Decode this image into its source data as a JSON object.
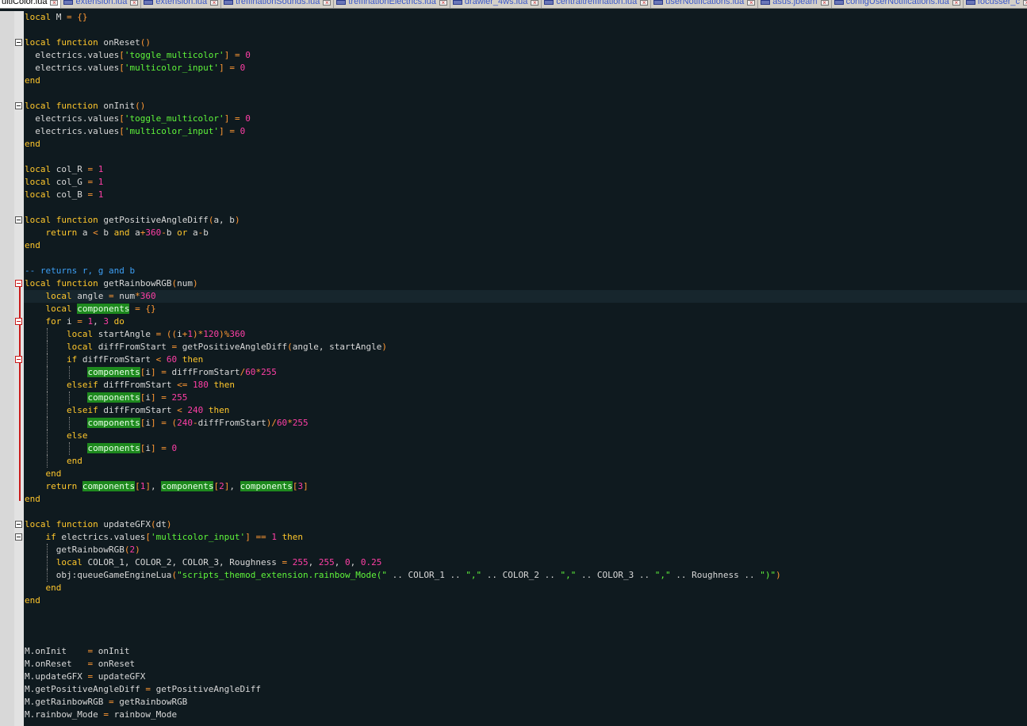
{
  "tabs": [
    {
      "label": "ultiColor.lua",
      "active": true
    },
    {
      "label": "extension.lua"
    },
    {
      "label": "extension.lua"
    },
    {
      "label": "treffinationSounds.lua"
    },
    {
      "label": "treffinationElectrics.lua"
    },
    {
      "label": "drawler_4ws.lua"
    },
    {
      "label": "centraltreffination.lua"
    },
    {
      "label": "userNotifications.lua"
    },
    {
      "label": "asus.jbeam"
    },
    {
      "label": "configUserNotifications.lua"
    },
    {
      "label": "focusser_c"
    }
  ],
  "editor": {
    "current_line": 23,
    "lines": [
      {
        "text": "local M = {}"
      },
      {
        "text": ""
      },
      {
        "text": "local function onReset()",
        "fold": true
      },
      {
        "text": "  electrics.values['toggle_multicolor'] = 0"
      },
      {
        "text": "  electrics.values['multicolor_input'] = 0"
      },
      {
        "text": "end"
      },
      {
        "text": ""
      },
      {
        "text": "local function onInit()",
        "fold": true
      },
      {
        "text": "  electrics.values['toggle_multicolor'] = 0"
      },
      {
        "text": "  electrics.values['multicolor_input'] = 0"
      },
      {
        "text": "end"
      },
      {
        "text": ""
      },
      {
        "text": "local col_R = 1"
      },
      {
        "text": "local col_G = 1"
      },
      {
        "text": "local col_B = 1"
      },
      {
        "text": ""
      },
      {
        "text": "local function getPositiveAngleDiff(a, b)",
        "fold": true
      },
      {
        "text": "    return a < b and a+360-b or a-b"
      },
      {
        "text": "end"
      },
      {
        "text": ""
      },
      {
        "text": "-- returns r, g and b"
      },
      {
        "text": "local function getRainbowRGB(num)",
        "fold": true,
        "fold_red": true
      },
      {
        "text": "    local angle = num*360"
      },
      {
        "text": "    local components = {}"
      },
      {
        "text": "    for i = 1, 3 do",
        "fold": true,
        "fold_red": true
      },
      {
        "text": "        local startAngle = ((i+1)*120)%360"
      },
      {
        "text": "        local diffFromStart = getPositiveAngleDiff(angle, startAngle)"
      },
      {
        "text": "        if diffFromStart < 60 then",
        "fold": true,
        "fold_red": true
      },
      {
        "text": "            components[i] = diffFromStart/60*255"
      },
      {
        "text": "        elseif diffFromStart <= 180 then"
      },
      {
        "text": "            components[i] = 255"
      },
      {
        "text": "        elseif diffFromStart < 240 then"
      },
      {
        "text": "            components[i] = (240-diffFromStart)/60*255"
      },
      {
        "text": "        else"
      },
      {
        "text": "            components[i] = 0"
      },
      {
        "text": "        end"
      },
      {
        "text": "    end"
      },
      {
        "text": "    return components[1], components[2], components[3]"
      },
      {
        "text": "end"
      },
      {
        "text": ""
      },
      {
        "text": "local function updateGFX(dt)",
        "fold": true
      },
      {
        "text": "    if electrics.values['multicolor_input'] == 1 then",
        "fold": true
      },
      {
        "text": "      getRainbowRGB(2)"
      },
      {
        "text": "      local COLOR_1, COLOR_2, COLOR_3, Roughness = 255, 255, 0, 0.25"
      },
      {
        "text": "      obj:queueGameEngineLua(\"scripts_themod_extension.rainbow_Mode(\" .. COLOR_1 .. \",\" .. COLOR_2 .. \",\" .. COLOR_3 .. \",\" .. Roughness .. \")\")"
      },
      {
        "text": "    end"
      },
      {
        "text": "end"
      },
      {
        "text": ""
      },
      {
        "text": ""
      },
      {
        "text": ""
      },
      {
        "text": "M.onInit    = onInit"
      },
      {
        "text": "M.onReset   = onReset"
      },
      {
        "text": "M.updateGFX = updateGFX"
      },
      {
        "text": "M.getPositiveAngleDiff = getPositiveAngleDiff"
      },
      {
        "text": "M.getRainbowRGB = getRainbowRGB"
      },
      {
        "text": "M.rainbow_Mode = rainbow_Mode"
      }
    ]
  },
  "syntax": {
    "keywords": [
      "local",
      "function",
      "end",
      "return",
      "and",
      "or",
      "for",
      "do",
      "if",
      "then",
      "elseif",
      "else"
    ],
    "highlight_word": "components",
    "colors": {
      "background": "#0f1a1f",
      "text": "#d9d9d9",
      "keyword": "#ffc72c",
      "punct": "#ff9833",
      "number": "#ff3fa6",
      "string": "#5ff53b",
      "comment": "#3d9ff5",
      "highlight": "#1e8a1e"
    }
  }
}
